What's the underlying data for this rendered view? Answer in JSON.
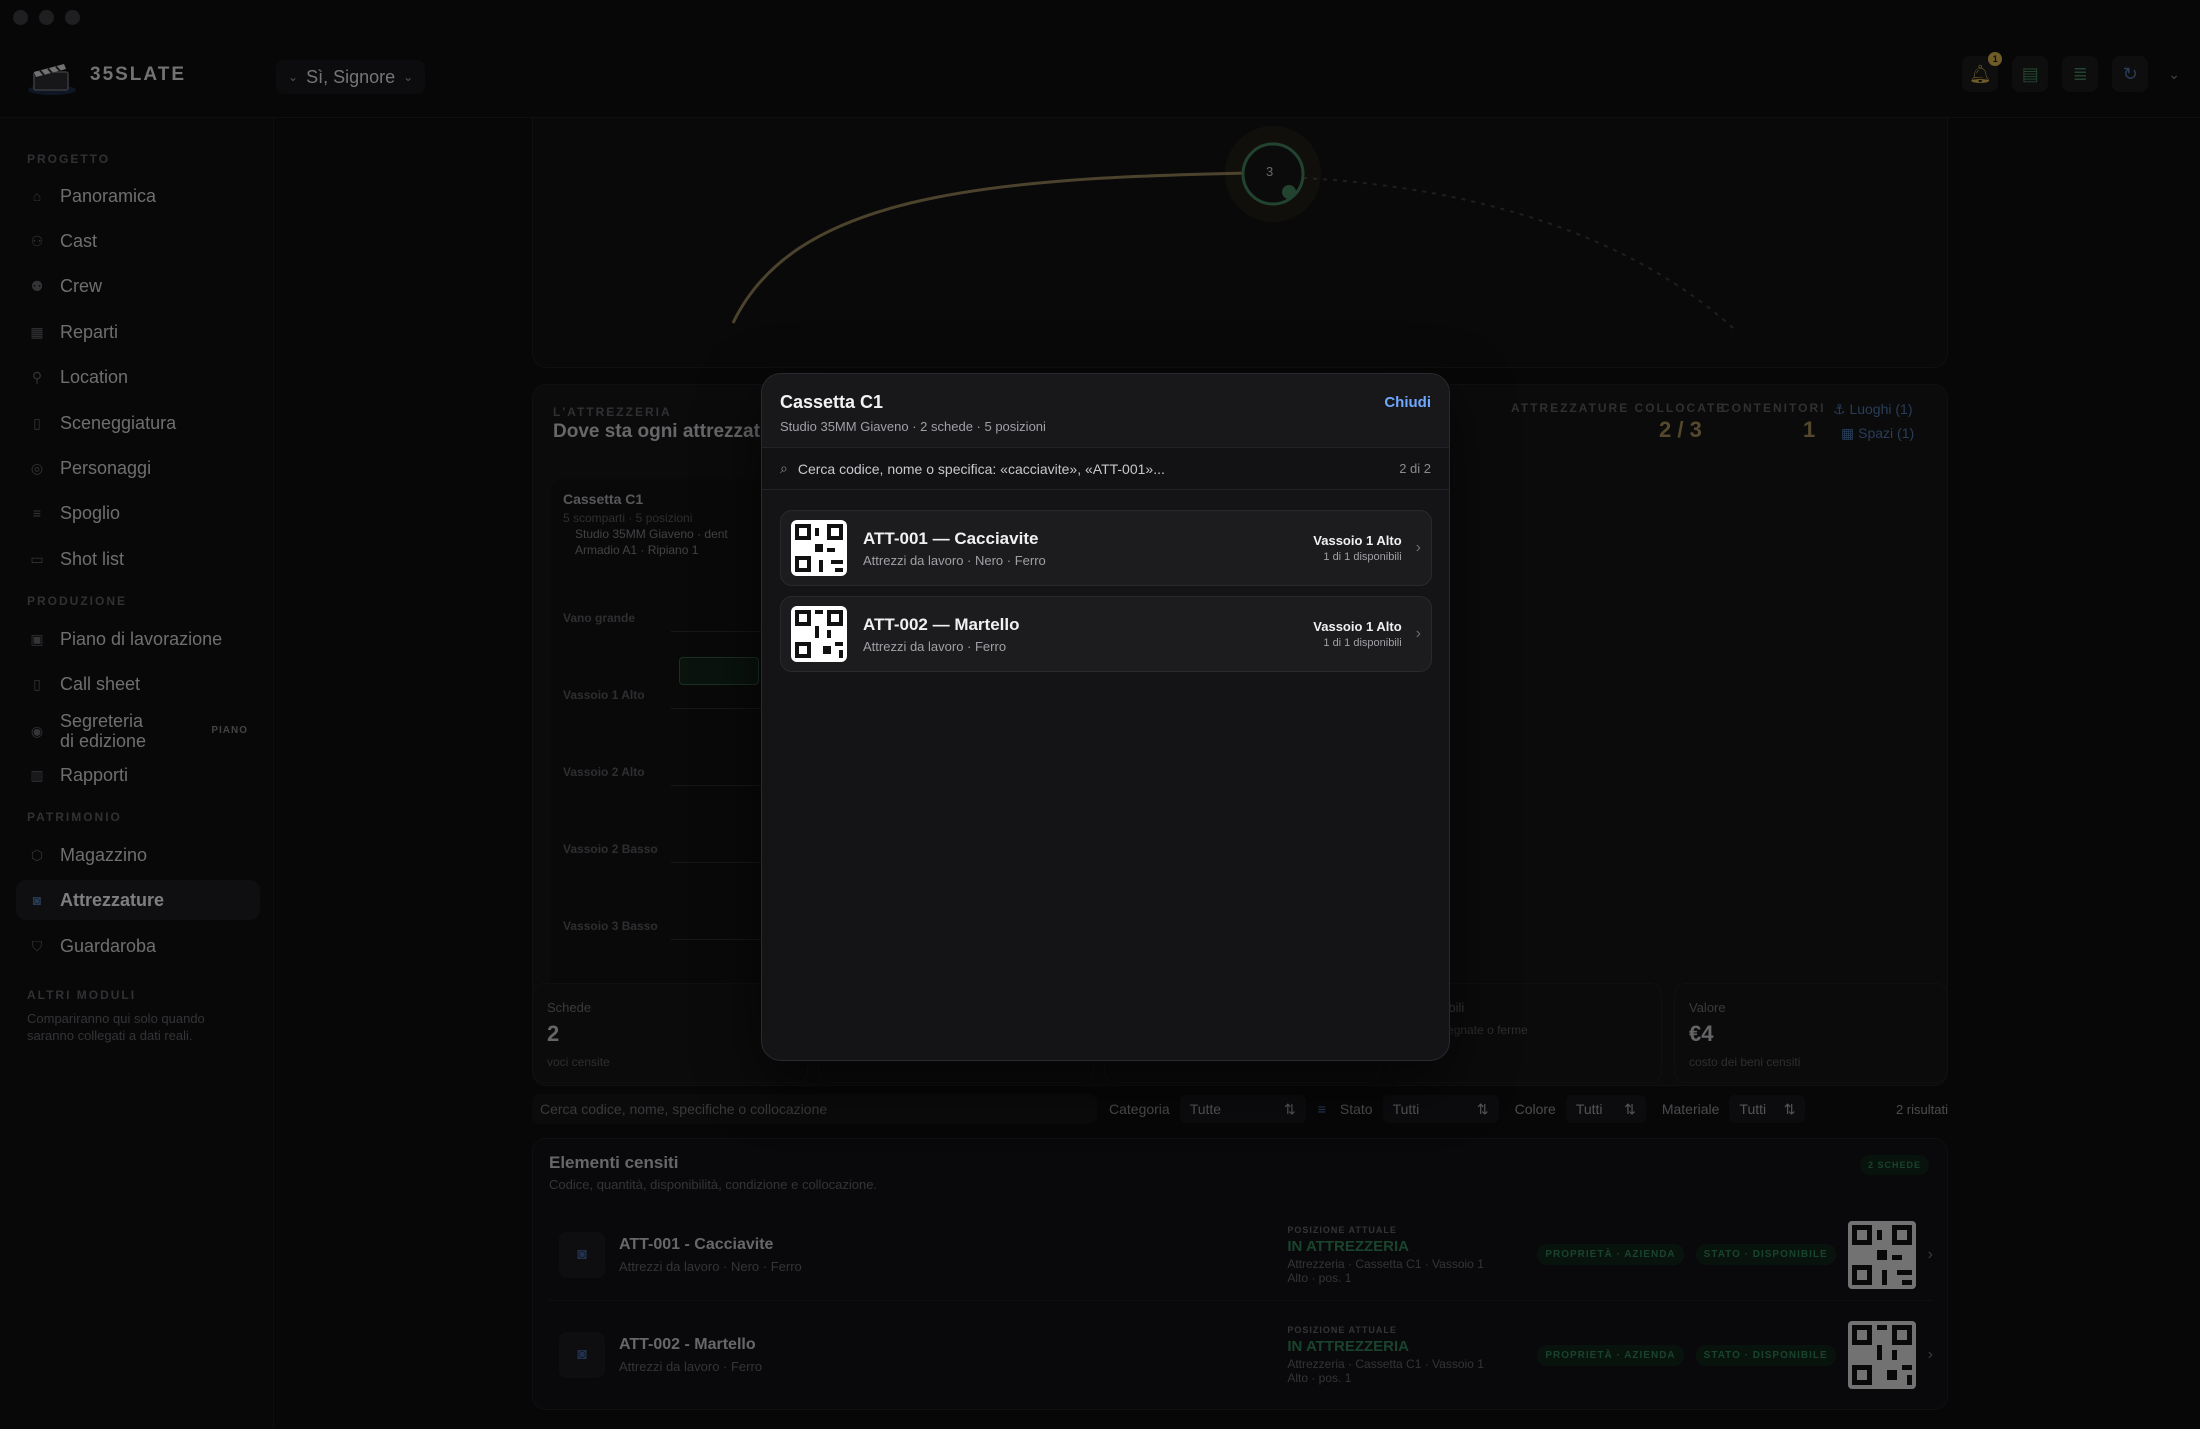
{
  "app": {
    "brand": "35SLATE",
    "project": "Sì, Signore",
    "notification_count": "1"
  },
  "sidebar": {
    "sections": [
      "PROGETTO",
      "PRODUZIONE",
      "PATRIMONIO",
      "ALTRI MODULI"
    ],
    "items": [
      {
        "label": "Panoramica"
      },
      {
        "label": "Cast"
      },
      {
        "label": "Crew"
      },
      {
        "label": "Reparti"
      },
      {
        "label": "Location"
      },
      {
        "label": "Sceneggiatura"
      },
      {
        "label": "Personaggi"
      },
      {
        "label": "Spoglio"
      },
      {
        "label": "Shot list"
      },
      {
        "label": "Piano di lavorazione"
      },
      {
        "label": "Call sheet"
      },
      {
        "label": "Segreteria",
        "label2": "di edizione",
        "badge": "PIANO"
      },
      {
        "label": "Rapporti"
      },
      {
        "label": "Magazzino"
      },
      {
        "label": "Attrezzature"
      },
      {
        "label": "Guardaroba"
      }
    ],
    "altri_note": "Compariranno qui solo quando saranno collegati a dati reali."
  },
  "graph": {
    "node_label": "3"
  },
  "attrezzeria": {
    "kicker": "L'ATTREZZERIA",
    "title": "Dove sta ogni attrezzatura",
    "collocate_label": "ATTREZZATURE COLLOCATE",
    "collocate_value": "2 / 3",
    "contenitori_label": "CONTENITORI",
    "contenitori_value": "1",
    "luoghi": "Luoghi (1)",
    "spazi": "Spazi (1)",
    "cassetta_title": "Cassetta C1",
    "cassetta_sub": "5 scomparti · 5 posizioni",
    "cassetta_loc1": "Studio 35MM Giaveno · dent",
    "cassetta_loc2": "Armadio A1 · Ripiano 1",
    "slots": [
      "Vano grande",
      "Vassoio 1 Alto",
      "Vassoio 2 Alto",
      "Vassoio 2 Basso",
      "Vassoio 3 Basso"
    ],
    "slot_count": "2"
  },
  "stats": [
    {
      "label": "Schede",
      "value": "2",
      "sub": "voci censite"
    },
    {
      "label": "Disponibili",
      "value": "",
      "sub": "non assegnate o ferme"
    },
    {
      "label": "Valore",
      "value": "€4",
      "sub": "costo dei beni censiti"
    }
  ],
  "filters": {
    "search_placeholder": "Cerca codice, nome, specifiche o collocazione",
    "categoria_label": "Categoria",
    "categoria_value": "Tutte",
    "stato_label": "Stato",
    "stato_value": "Tutti",
    "colore_label": "Colore",
    "colore_value": "Tutti",
    "materiale_label": "Materiale",
    "materiale_value": "Tutti",
    "results": "2 risultati"
  },
  "elementi": {
    "title": "Elementi censiti",
    "subtitle": "Codice, quantità, disponibilità, condizione e collocazione.",
    "badge": "2 SCHEDE",
    "rows": [
      {
        "title": "ATT-001 - Cacciavite",
        "sub": "Attrezzi da lavoro · Nero · Ferro",
        "pos_label": "POSIZIONE ATTUALE",
        "pos_value": "IN ATTREZZERIA",
        "pos_detail1": "Attrezzeria · Cassetta C1 · Vassoio 1",
        "pos_detail2": "Alto · pos. 1",
        "pill1": "PROPRIETÀ · AZIENDA",
        "pill2": "STATO · DISPONIBILE"
      },
      {
        "title": "ATT-002 - Martello",
        "sub": "Attrezzi da lavoro · Ferro",
        "pos_label": "POSIZIONE ATTUALE",
        "pos_value": "IN ATTREZZERIA",
        "pos_detail1": "Attrezzeria · Cassetta C1 · Vassoio 1",
        "pos_detail2": "Alto · pos. 1",
        "pill1": "PROPRIETÀ · AZIENDA",
        "pill2": "STATO · DISPONIBILE"
      }
    ]
  },
  "modal": {
    "title": "Cassetta C1",
    "subtitle": "Studio 35MM Giaveno · 2 schede · 5 posizioni",
    "close": "Chiudi",
    "search_placeholder": "Cerca codice, nome o specifica: «cacciavite», «ATT-001»...",
    "count": "2 di 2",
    "items": [
      {
        "title": "ATT-001 — Cacciavite",
        "sub": "Attrezzi da lavoro · Nero · Ferro",
        "slot": "Vassoio 1 Alto",
        "avail": "1 di 1 disponibili"
      },
      {
        "title": "ATT-002 — Martello",
        "sub": "Attrezzi da lavoro · Ferro",
        "slot": "Vassoio 1 Alto",
        "avail": "1 di 1 disponibili"
      }
    ]
  }
}
